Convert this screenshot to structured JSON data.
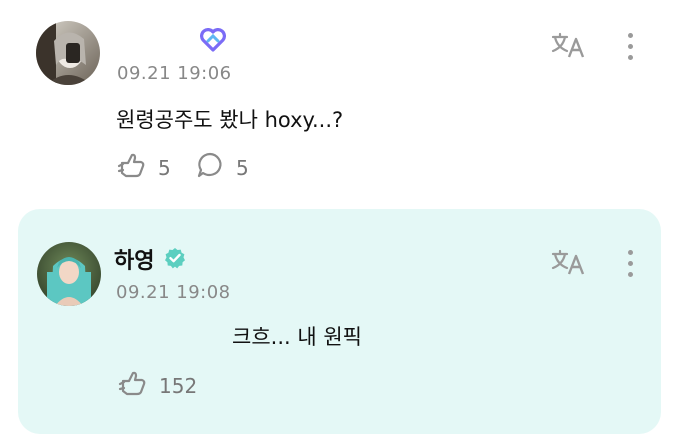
{
  "comment": {
    "time": "09.21 19:06",
    "text": "원령공주도 봤나 hoxy...?",
    "likes": "5",
    "replies": "5"
  },
  "reply": {
    "author": "하영",
    "time": "09.21 19:08",
    "text": "크흐... 내 원픽",
    "likes": "152"
  },
  "colors": {
    "reply_background": "#e4f8f6",
    "verified_badge": "#5ccfc0",
    "fandom_badge": "#7b6cf6",
    "icon_gray": "#9a9a9a",
    "meta_gray": "#888888"
  },
  "icons": {
    "translate": "translate-icon",
    "more": "more-vertical-icon",
    "like": "like-hand-icon",
    "reply": "speech-bubble-icon",
    "verified": "verified-check-icon",
    "badge": "fandom-heart-badge-icon"
  }
}
